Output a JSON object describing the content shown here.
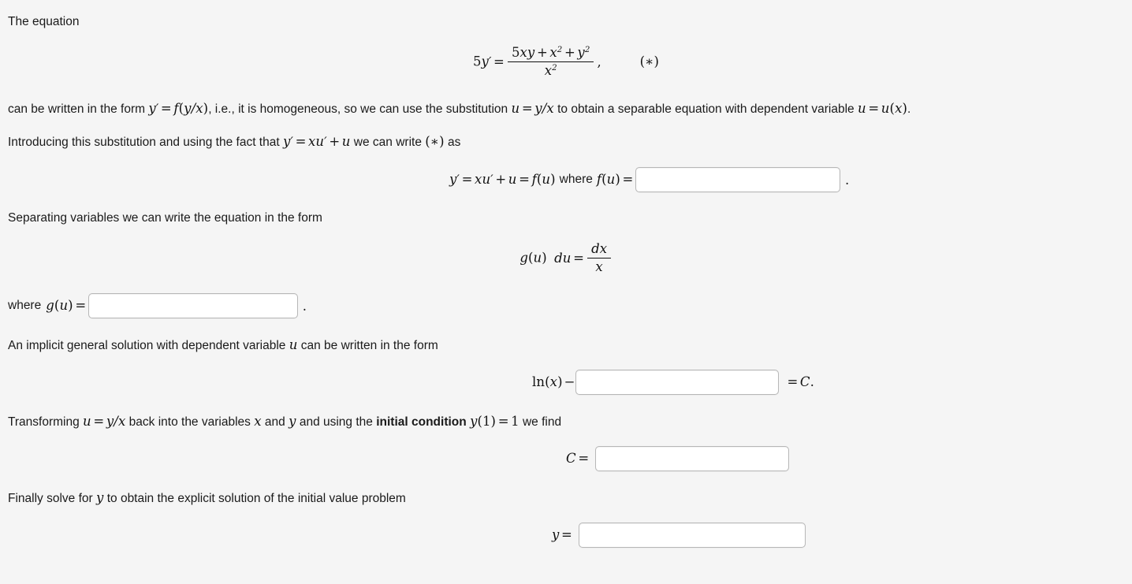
{
  "page": {
    "background_color": "#f5f5f5",
    "text_color": "#1a1a1a"
  },
  "intro": {
    "line1": "The equation"
  },
  "equation_star": {
    "lhs_coefficient": "5",
    "lhs_var": "y",
    "lhs_prime": "′",
    "equals": "=",
    "numerator_a": "5",
    "numerator_b": "xy",
    "plus1": "+",
    "numerator_c": "x",
    "numerator_c_exp": "2",
    "plus2": "+",
    "numerator_d": "y",
    "numerator_d_exp": "2",
    "denominator": "x",
    "denominator_exp": "2",
    "comma": ",",
    "tag": "(∗)"
  },
  "paragraph_homogeneous": {
    "t1": "can be written in the form ",
    "m1_y": "y",
    "m1_prime": "′",
    "m1_eq": "=",
    "m1_f": "f",
    "m1_open": "(",
    "m1_ynum": "y",
    "m1_slash": "/",
    "m1_xden": "x",
    "m1_close": ")",
    "t2": ", i.e., it is homogeneous, so we can use the substitution ",
    "m2_u": "u",
    "m2_eq": "=",
    "m2_y": "y",
    "m2_slash": "/",
    "m2_x": "x",
    "t3": " to obtain a separable equation with dependent variable ",
    "m3_u": "u",
    "m3_eq": "=",
    "m3_ux": "u",
    "m3_open": "(",
    "m3_x": "x",
    "m3_close": ")",
    "t4": "."
  },
  "paragraph_substitution": {
    "t1": "Introducing this substitution and using the fact that ",
    "m_y": "y",
    "m_prime": "′",
    "m_eq": "=",
    "m_x": "x",
    "m_u": "u",
    "m_u_prime": "′",
    "m_plus": "+",
    "m_u2": "u",
    "t2": " we can write ",
    "tag": "(∗)",
    "t3": " as"
  },
  "row_fu": {
    "y": "y",
    "prime": "′",
    "eq1": "=",
    "x": "x",
    "u": "u",
    "u_prime": "′",
    "plus": "+",
    "u2": "u",
    "eq2": "=",
    "f": "f",
    "open": "(",
    "u3": "u",
    "close": ")",
    "where": "where",
    "f2": "f",
    "open2": "(",
    "u4": "u",
    "close2": ")",
    "eq3": "=",
    "input_value": "",
    "input_placeholder": "",
    "period": "."
  },
  "paragraph_separating": {
    "text": "Separating variables we can write the equation in the form"
  },
  "equation_separated": {
    "g": "g",
    "open": "(",
    "u": "u",
    "close": ")",
    "du": "du",
    "eq": "=",
    "num_d": "d",
    "num_x": "x",
    "den_x": "x"
  },
  "row_gu": {
    "where": "where",
    "g": "g",
    "open": "(",
    "u": "u",
    "close": ")",
    "eq": "=",
    "input_value": "",
    "input_placeholder": "",
    "period": "."
  },
  "paragraph_implicit": {
    "t1": "An implicit general solution with dependent variable ",
    "m_u": "u",
    "t2": " can be written in the form"
  },
  "row_implicit": {
    "ln": "ln",
    "open": "(",
    "x": "x",
    "close": ")",
    "minus": "−",
    "input_value": "",
    "input_placeholder": "",
    "eq": "=",
    "C": "C",
    "period": "."
  },
  "paragraph_transform": {
    "t1": "Transforming ",
    "m_u": "u",
    "m_eq": "=",
    "m_y": "y",
    "m_slash": "/",
    "m_x": "x",
    "t2": " back into the variables ",
    "m_x2": "x",
    "t3": " and ",
    "m_y2": "y",
    "t4": " and using the ",
    "bold": "initial condition",
    "t5": " ",
    "m_y3": "y",
    "m_open": "(",
    "m_one": "1",
    "m_close": ")",
    "m_eq2": "=",
    "m_one2": "1",
    "t6": " we find"
  },
  "row_C": {
    "C": "C",
    "eq": "=",
    "input_value": "",
    "input_placeholder": ""
  },
  "paragraph_finally": {
    "t1": "Finally solve for ",
    "m_y": "y",
    "t2": " to obtain the explicit solution of the initial value problem"
  },
  "row_y": {
    "y": "y",
    "eq": "=",
    "input_value": "",
    "input_placeholder": ""
  }
}
